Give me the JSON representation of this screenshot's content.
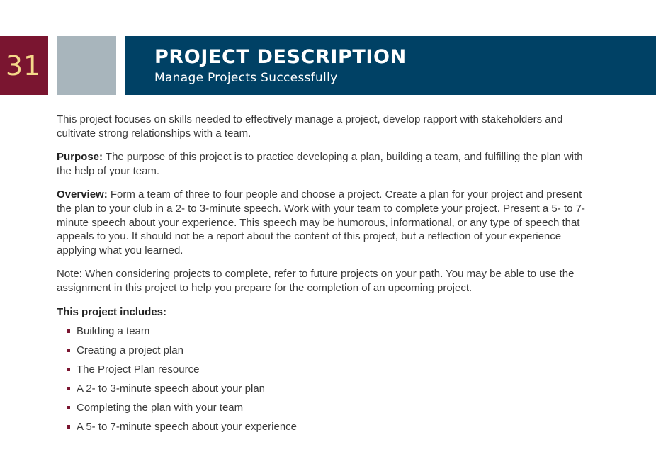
{
  "page_number": "31",
  "header": {
    "title": "PROJECT DESCRIPTION",
    "subtitle": "Manage Projects Successfully"
  },
  "colors": {
    "page_number_bg": "#7a1530",
    "page_number_text": "#f5d98a",
    "gray_block": "#a8b5bc",
    "title_band": "#004165",
    "bullet": "#7a1530"
  },
  "intro": "This project focuses on skills needed to effectively manage a project, develop rapport with stakeholders and cultivate strong relationships with a team.",
  "purpose": {
    "label": "Purpose:",
    "text": " The purpose of this project is to practice developing a plan, building a team, and fulfilling the plan with the help of your team."
  },
  "overview": {
    "label": "Overview:",
    "text": " Form a team of three to four people and choose a project. Create a plan for your project and present the plan to your club in a 2- to 3-minute speech. Work with your team to complete your project. Present a 5- to 7-minute speech about your experience. This speech may be humorous, informational, or any type of speech that appeals to you. It should not be a report about the content of this project, but a reflection of your experience applying what you learned."
  },
  "note": "Note: When considering projects to complete, refer to future projects on your path. You may be able to use the assignment in this project to help you prepare for the completion of an upcoming project.",
  "includes": {
    "heading": "This project includes:",
    "items": [
      "Building a team",
      "Creating a project plan",
      "The Project Plan resource",
      "A 2- to 3-minute speech about your plan",
      "Completing the plan with your team",
      "A 5- to 7-minute speech about your experience"
    ]
  }
}
